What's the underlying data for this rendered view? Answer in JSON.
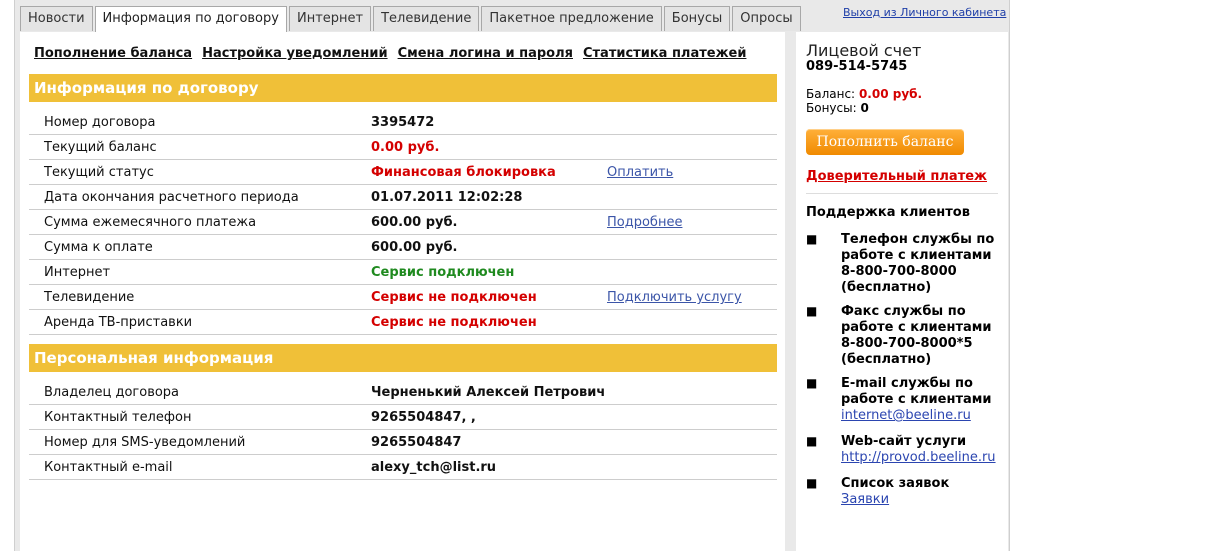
{
  "tabs": [
    "Новости",
    "Информация по договору",
    "Интернет",
    "Телевидение",
    "Пакетное предложение",
    "Бонусы",
    "Опросы"
  ],
  "logout": "Выход из Личного кабинета",
  "sublinks": [
    "Пополнение баланса",
    "Настройка уведомлений",
    "Смена логина и пароля",
    "Статистика платежей"
  ],
  "contract": {
    "title": "Информация по договору",
    "rows": [
      {
        "label": "Номер договора",
        "value": "3395472"
      },
      {
        "label": "Текущий баланс",
        "value": "0.00 руб."
      },
      {
        "label": "Текущий статус",
        "value": "Финансовая блокировка",
        "action": "Оплатить"
      },
      {
        "label": "Дата окончания расчетного периода",
        "value": "01.07.2011 12:02:28"
      },
      {
        "label": "Сумма ежемесячного платежа",
        "value": "600.00 руб.",
        "action": "Подробнее"
      },
      {
        "label": "Сумма к оплате",
        "value": "600.00 руб."
      },
      {
        "label": "Интернет",
        "value": "Сервис подключен"
      },
      {
        "label": "Телевидение",
        "value": "Сервис не подключен",
        "action": "Подключить услугу"
      },
      {
        "label": "Аренда ТВ-приставки",
        "value": "Сервис не подключен"
      }
    ]
  },
  "personal": {
    "title": "Персональная информация",
    "rows": [
      {
        "label": "Владелец договора",
        "value": "Черненький Алексей Петрович"
      },
      {
        "label": "Контактный телефон",
        "value": "9265504847, ,"
      },
      {
        "label": "Номер для SMS-уведомлений",
        "value": "9265504847"
      },
      {
        "label": "Контактный e-mail",
        "value": "alexy_tch@list.ru"
      }
    ]
  },
  "account": {
    "title": "Лицевой счет",
    "number": "089-514-5745",
    "balance_label": "Баланс:",
    "balance_value": "0.00 руб.",
    "bonus_label": "Бонусы:",
    "bonus_value": "0",
    "topup_button": "Пополнить баланс",
    "trust_payment": "Доверительный платеж"
  },
  "support": {
    "title": "Поддержка клиентов",
    "items": [
      {
        "text": "Телефон службы по работе с клиентами 8-800-700-8000 (бесплатно)"
      },
      {
        "text": "Факс службы по работе с клиентами 8-800-700-8000*5 (бесплатно)"
      },
      {
        "text": "E-mail службы по работе с клиентами",
        "link": "internet@beeline.ru"
      },
      {
        "text": "Web-сайт услуги",
        "link": "http://provod.beeline.ru"
      },
      {
        "text": "Список заявок",
        "link": "Заявки"
      }
    ]
  },
  "colors": {
    "accent": "#f0c038",
    "alert": "#d40000",
    "ok": "#1f8a1f",
    "link": "#3b55a8"
  }
}
